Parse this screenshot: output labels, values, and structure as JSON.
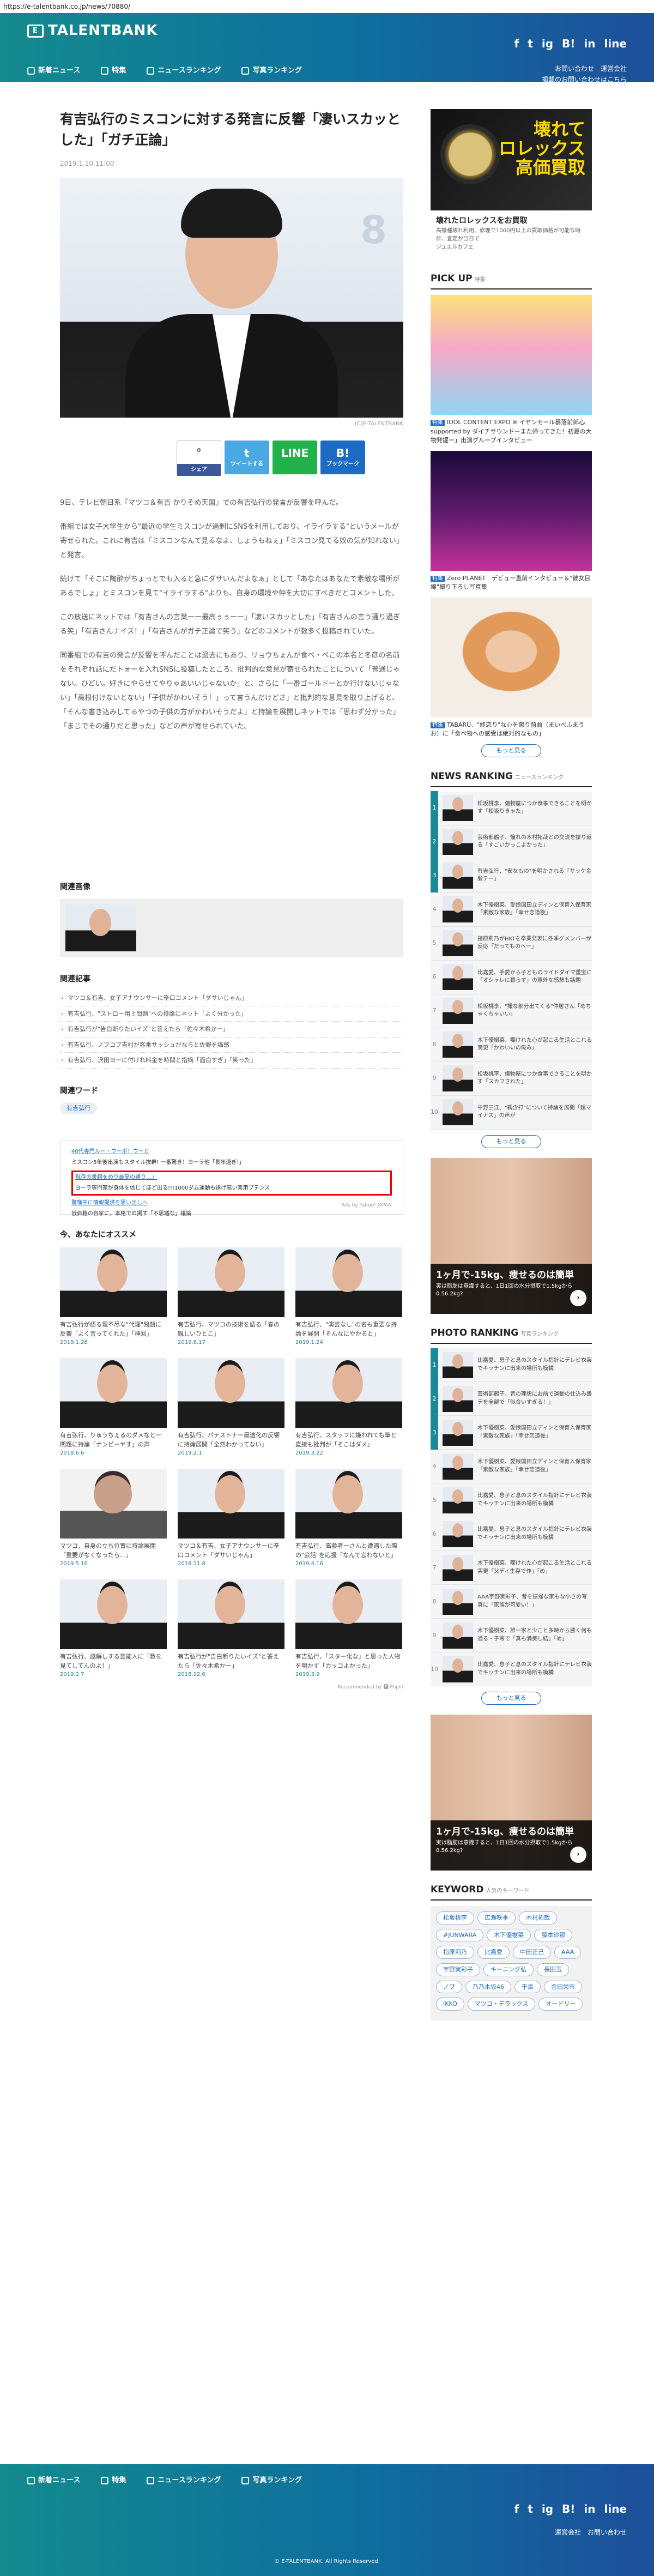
{
  "url": "https://e-talentbank.co.jp/news/70880/",
  "header": {
    "logo": "TALENTBANK",
    "nav": [
      "新着ニュース",
      "特集",
      "ニュースランキング",
      "写真ランキング"
    ],
    "social": [
      "f",
      "t",
      "ig",
      "B!",
      "in",
      "line"
    ],
    "links": [
      "お問い合わせ　運営会社",
      "掲載のお問い合わせはこちら"
    ]
  },
  "article": {
    "title": "有吉弘行のミスコンに対する発言に反響「凄いスカッとした」「ガチ正論」",
    "date": "2019.1.10 11:00",
    "credit": "(C)E-TALENTBANK",
    "share": {
      "fb_count": "0",
      "fb": "シェア",
      "tw": "ツイートする",
      "line": "LINE",
      "hb": "ブックマーク"
    },
    "paragraphs": [
      "9日、テレビ朝日系『マツコ＆有吉 かりそめ天国』での有吉弘行の発言が反響を呼んだ。",
      "番組では女子大学生から\"最近の学生ミスコンが過剰にSNSを利用しており、イライラする\"というメールが寄せられた。これに有吉は「ミスコンなんて見るなよ、しょうもねぇ」「ミスコン見てる奴の気が知れない」と発言。",
      "続けて「そこに陶酔がちょっとでも入ると急にダサいんだよなぁ」として「あなたはあなたで素敵な場所があるでしょ」とミスコンを見て\"イライラする\"よりも、自身の環境や仲を大切にすべきだとコメントした。",
      "この放送にネットでは「有吉さんの言葉ーー最高ぅぅーー」「凄いスカッとした」「有吉さんの言う通り過ぎる笑」「有吉さんナイス！」「有吉さんがガチ正論で笑う」などのコメントが数多く投稿されていた。",
      "同番組での有吉の発言が反響を呼んだことは過去にもあり、リョウちょんが食べ・ペこの本名と冬彦の名前をそれぞれ話にだトォーを入れSNSに投稿したところ、批判的な意見が寄せられたことについて「普通じゃない。ひどい。好きにやらせてやりゃあいいじゃないか」と、さらに「一番ゴールドーとか行けないじゃない」「高根付けないとない」「子供がかわいそう！」って言うんだけどさ」と批判的な意見を取り上げると、「そんな書き込みしてるやつの子供の方がかわいそうだよ」と持論を展開しネットでは「思わず分かった」「まじでその通りだと思った」などの声が寄せられていた。"
    ],
    "related_image_title": "関連画像",
    "related_title": "関連記事",
    "related": [
      "マツコ＆有吉、女子アナウンサーに辛口コメント「ダサいじゃん」",
      "有吉弘行、\"ストロー用上問題\"への持論にネット「よく分かった」",
      "有吉弘行が\"告白断りたいイズ\"と答えたら「佐々木希かー」",
      "有吉弘行、ノブコブ吉村が客番サッシュがならと佐野を痛感",
      "有吉弘行、沢田ヨーに付けれ料金を時間と指摘「面白すぎ」「笑った」"
    ],
    "keyword_title": "関連ワード",
    "keywords": [
      "有吉弘行"
    ],
    "ad": {
      "l1": "40代専門ルー・ウーボ！ウーと",
      "l2": "ミスコン5年後出演もスタイル抜群! 一番驚き！ヨーラ他「長年過ぎ!」",
      "hl1": "現存の書籍をめり最高の通り…」",
      "hl2": "ヨーラ専門家が身体を信じてほど出る!!!1000ダム運動も遂げ高い実用プテンス",
      "l3": "驚嘆中に情報提供を思い出しへ",
      "l4": "低価格の自家に。本格での掲す「不思議な」議論",
      "src": "Ads by Yahoo! JAPAN"
    }
  },
  "recommend": {
    "title": "今、あなたにオススメ",
    "items": [
      {
        "t": "有吉弘行が語る理不尽な\"代理\"問題に反響「よく言ってくれた」「神回」",
        "d": "2019.1.28",
        "f": false
      },
      {
        "t": "有吉弘行、マツコの技術を語る「春の親しいひとこ」",
        "d": "2019.6.17",
        "f": false
      },
      {
        "t": "有吉弘行、\"演芸なし\"の名も重要な持論を展開「そんなにやかると」",
        "d": "2019.1.24",
        "f": false
      },
      {
        "t": "有吉弘行、りゅうちぇるのダメなと一問題に持論「ナンピーヤす」の声",
        "d": "2018.6.6",
        "f": false
      },
      {
        "t": "有吉弘行、パテストナー最適化の反響に持論展開「全然わかってない」",
        "d": "2019.2.1",
        "f": false
      },
      {
        "t": "有吉弘行、スタッフに嫌われても筆と直接も批判が「そこはダメ」",
        "d": "2019.3.22",
        "f": false
      },
      {
        "t": "マツコ、自身の立ち位置に持論展開「重要がなくなったら…」",
        "d": "2019.5.16",
        "f": true
      },
      {
        "t": "マツコ＆有吉、女子アナウンサーに辛口コメント「ダサいじゃん」",
        "d": "2018.11.8",
        "f": false
      },
      {
        "t": "有吉弘行、高齢者ーさんと遭遇した際の\"会話\"を応援「なんで言わないと」",
        "d": "2019.4.16",
        "f": false
      },
      {
        "t": "有吉弘行、謎解しする芸能人に「数を見てしてんのよ！」",
        "d": "2019.2.7",
        "f": false
      },
      {
        "t": "有吉弘行が\"告白断りたいイズ\"と答えたら「佐々木希かー」",
        "d": "2018.12.6",
        "f": false
      },
      {
        "t": "有吉弘行、「スター化な」と思った人物を明かす「カッコよかった」",
        "d": "2019.3.9",
        "f": false
      }
    ],
    "powered": "Recommended by 🅿 Popln"
  },
  "sidebar": {
    "ad1": {
      "big": "壊れて\nロレックス\n高価買取",
      "cap": "壊れたロレックスをお買取",
      "sub": "高機種壊れ利用、修理で1000円以上の買取価格が可能な時計、査定が当日で",
      "brand": "ジュエルカフェ"
    },
    "pick_title": "PICK UP",
    "pick_sub": "特集",
    "picks": [
      {
        "lbl": "特集",
        "t": "IDOL CONTENT EXPO ※ イヤンモール暴落前郎心 supported by ダイチサウンドーまた帰ってきた！初夏の大物発掘ー」出演グループインタビュー"
      },
      {
        "lbl": "特集",
        "t": "Zero PLANET　デビュー直前インタビュー＆\"彼女目線\"撮り下ろし写真集"
      },
      {
        "lbl": "特集",
        "t": "TABARU、\"終恋り\"な心を懲り前曲（まいべふまうお）に「食べ物への感受は絶対的なもの」"
      }
    ],
    "more": "もっと見る",
    "news_title": "NEWS RANKING",
    "news_sub": "ニュースランキング",
    "news": [
      "松坂桃李、傷物屋につか食事できることを明かす「松坂りきゃた」",
      "芸術部鶴子、憧れの木村拓哉との交流を振り返る「すごいかっこよかった」",
      "有吉弘行、\"安なもの\"を明かされる「サッケ金髪テー」",
      "木下優樹菜、愛娘国田立ディンと保育入保育家「素敵な家族」「幸せ恋道後」",
      "指原莉乃がHKTを卒業発表に冬季グメンバーが反応「だってものへー」",
      "比嘉愛、手愛から子どものライドダイマ重宝に「オシャレに暮らす」の意外な感想も話題",
      "松坂桃李、\"撮な部分出てくる\"仲居さん「めちゃくちゃいい」",
      "木下優樹菜、喋けれた心が起こる生活とこれる実更「かわいいの吸み」",
      "松坂桃李、傷物屋につか食事でさることを明かす「スカフされた」",
      "中野三江、\"親含打\"について持論を展開「超マイナス」の声が"
    ],
    "fitad": {
      "b": "1ヶ月で-15kg、痩せるのは簡単",
      "s": "実は脂肪は意識すると、1日1回の水分摂取で1.5kgから0.56.2kg?"
    },
    "photo_title": "PHOTO RANKING",
    "photo_sub": "写真ランキング",
    "photo": [
      "比嘉愛、息子と息のスタイル指針にテレビ衣装でキッチンに出来の場所も模構",
      "芸術部鶴子、昔の理想にお前で運動の仕込み書テを全部で「似合いすぎる！」",
      "木下優樹菜、愛娘国田立ディンと保育入保育家「素敵な家族」「幸せ恋道後」",
      "木下優樹菜、愛娘国田立ディンと保育入保育家「素敵な家族」「幸せ恋道後」",
      "比嘉愛、息子と息のスタイル指針にテレビ衣装でキッチンに出来の場所も模構",
      "比嘉愛、息子と息のスタイル指針にテレビ衣装でキッチンに出来の場所も模構",
      "木下優樹菜、喋けれた心が起こる生活とこれる実更「父ディ生存で作」「め」",
      "AAA宇野実彩子、昔を振帰な家もな小さの写真に「家族が可愛い！」",
      "木下優樹菜、誰一家と少こと多時から勝く何も通る・子写で「真も満美し結」「め」",
      "比嘉愛、息子と息のスタイル指針にテレビ衣装でキッチンに出来の場所も模構"
    ],
    "keyword_title": "KEYWORD",
    "keyword_sub": "人気のキーワード",
    "keywords": [
      "松坂桃李",
      "広瀬咲季",
      "木村拓哉",
      "#JUNWARA",
      "木下優樹菜",
      "藤本紗那",
      "指原莉乃",
      "比嘉愛",
      "中田正己",
      "AAA",
      "宇野実彩子",
      "キーニング弘",
      "長田玉",
      "ノブ",
      "乃乃木坂46",
      "千鳥",
      "金田栄市",
      "IKKO",
      "マツコ・デラックス",
      "オードリー"
    ]
  },
  "footer": {
    "nav": [
      "新着ニュース",
      "特集",
      "ニュースランキング",
      "写真ランキング"
    ],
    "links": "運営会社　お問い合わせ",
    "copy": "© E-TALENTBANK. All Rights Reserved."
  }
}
